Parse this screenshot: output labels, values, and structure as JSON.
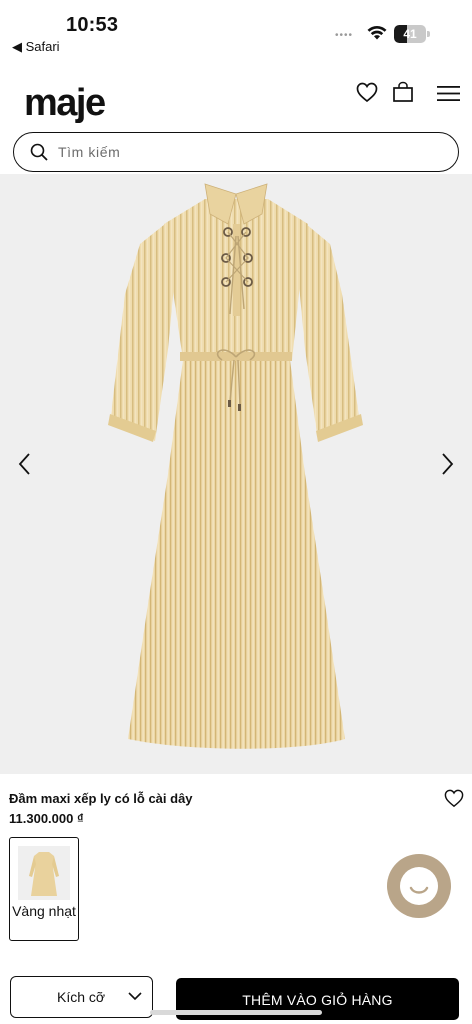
{
  "status_bar": {
    "time": "10:53",
    "back_label": "◀ Safari",
    "signal": "••••",
    "battery_level": "41",
    "battery_fraction": 0.41
  },
  "header": {
    "logo": "maje",
    "icons": [
      "heart-icon",
      "shopping-bag-icon",
      "menu-icon"
    ]
  },
  "search": {
    "placeholder": "Tìm kiếm",
    "value": ""
  },
  "gallery": {
    "prev_icon": "chevron-left-icon",
    "next_icon": "chevron-right-icon"
  },
  "product": {
    "title": "Đầm maxi xếp ly có lỗ cài dây",
    "price": "11.300.000 ₫",
    "color_label": "Vàng nhạt",
    "dress_colors": {
      "base": "#efdcae",
      "stripe": "#d9bf82",
      "background": "#efefef"
    }
  },
  "actions": {
    "size_label": "Kích cỡ",
    "add_to_cart": "THÊM VÀO GIỎ HÀNG"
  },
  "colors": {
    "chat_bubble": "#b9a589",
    "button": "#000000"
  }
}
